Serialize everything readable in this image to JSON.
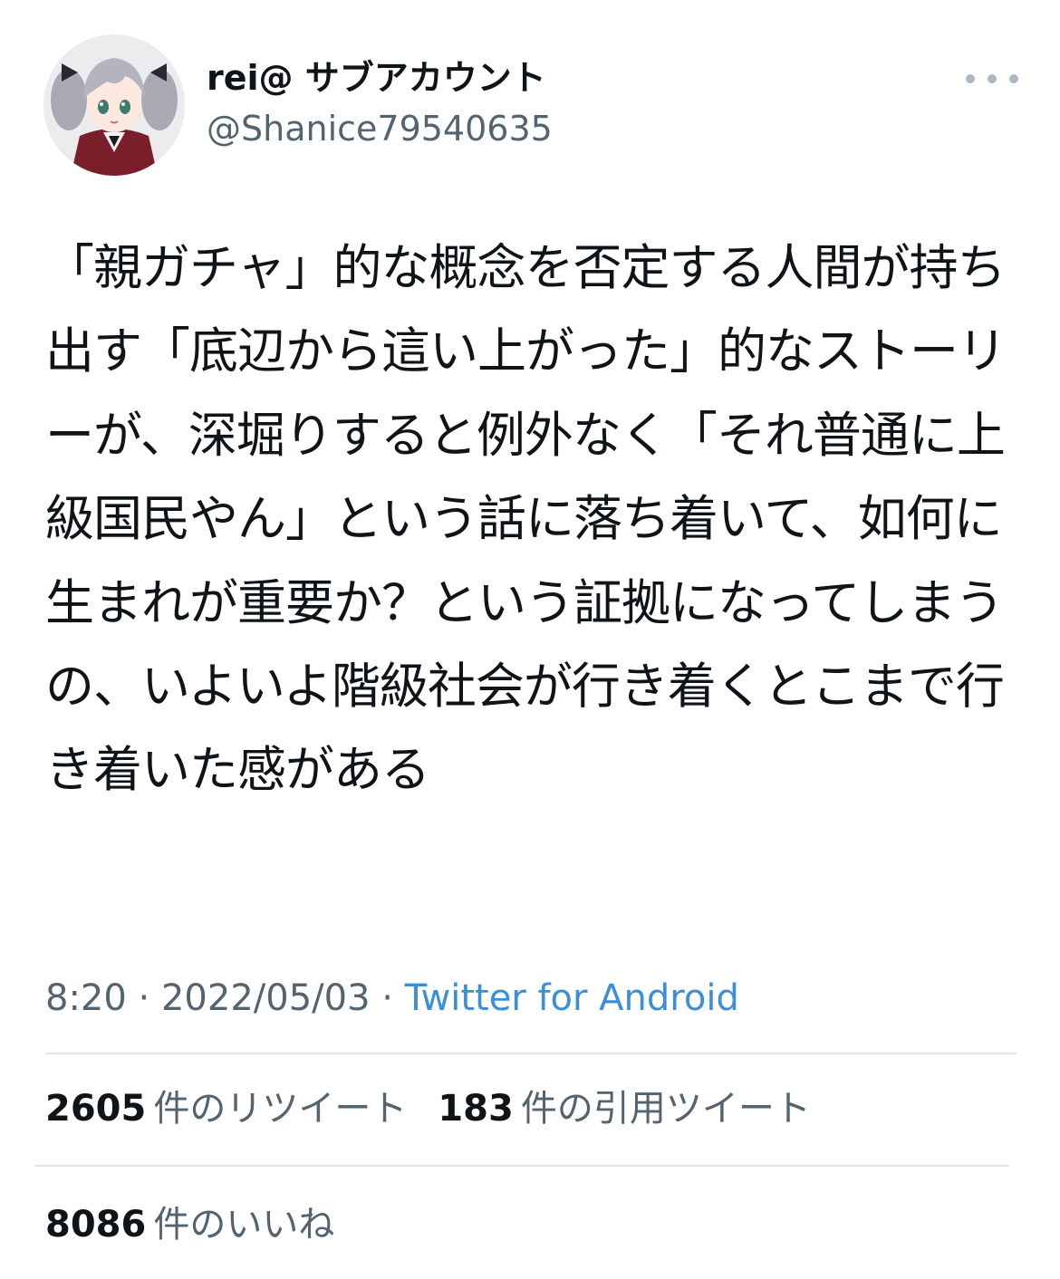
{
  "author": {
    "display_name": "rei@ サブアカウント",
    "handle": "@Shanice79540635"
  },
  "tweet": {
    "text": "「親ガチャ」的な概念を否定する人間が持ち出す「底辺から這い上がった」的なストーリーが、深堀りすると例外なく「それ普通に上級国民やん」という話に落ち着いて、如何に生まれが重要か？という証拠になってしまうの、いよいよ階級社会が行き着くとこまで行き着いた感がある",
    "time": "8:20",
    "date": "2022/05/03",
    "separator": "·",
    "source": "Twitter for Android"
  },
  "stats": {
    "retweets": {
      "count": "2605",
      "label": "件のリツイート"
    },
    "quotes": {
      "count": "183",
      "label": "件の引用ツイート"
    },
    "likes": {
      "count": "8086",
      "label": "件のいいね"
    }
  },
  "icons": {
    "more": "more-horizontal-icon",
    "avatar": "anime-character-avatar"
  },
  "colors": {
    "text": "#0f1419",
    "secondary": "#536471",
    "link": "#3b8fd9",
    "divider": "#e1e4e8"
  }
}
